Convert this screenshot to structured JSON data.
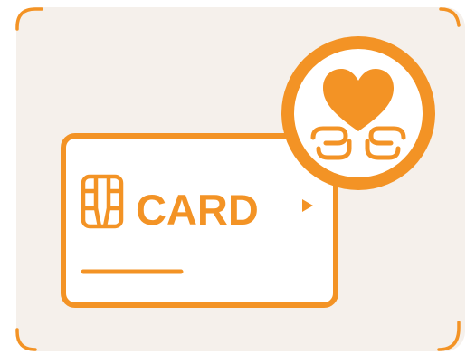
{
  "illustration": {
    "card_text": "CARD",
    "colors": {
      "accent": "#F39325",
      "panel_background": "#F5F0EB",
      "card_fill": "#FFFFFF",
      "badge_fill": "#FFFFFF"
    },
    "icons": [
      "chip-icon",
      "play-arrow-icon",
      "heart-icon",
      "caring-hands-icon"
    ]
  }
}
